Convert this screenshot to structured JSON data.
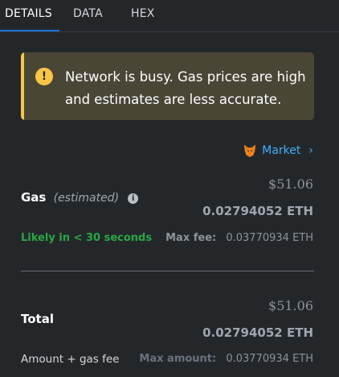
{
  "tabs": [
    {
      "label": "DETAILS"
    },
    {
      "label": "DATA"
    },
    {
      "label": "HEX"
    }
  ],
  "warning": {
    "icon": "!",
    "text": "Network is busy. Gas prices are high and estimates are less accurate."
  },
  "market": {
    "label": "Market",
    "chevron": "›"
  },
  "gas": {
    "label": "Gas",
    "qualifier": "(estimated)",
    "info_icon": "i",
    "usd": "$51.06",
    "eth": "0.02794052 ETH",
    "likely": "Likely in < 30 seconds",
    "max_fee_label": "Max fee:",
    "max_fee_value": "0.03770934 ETH"
  },
  "total": {
    "label": "Total",
    "usd": "$51.06",
    "eth": "0.02794052 ETH",
    "sublabel": "Amount + gas fee",
    "max_amount_label": "Max amount:",
    "max_amount_value": "0.03770934 ETH"
  },
  "colors": {
    "accent_blue": "#1a73d9",
    "warning_yellow": "#f8c545",
    "success_green": "#28a745",
    "link_blue": "#43aefc"
  }
}
